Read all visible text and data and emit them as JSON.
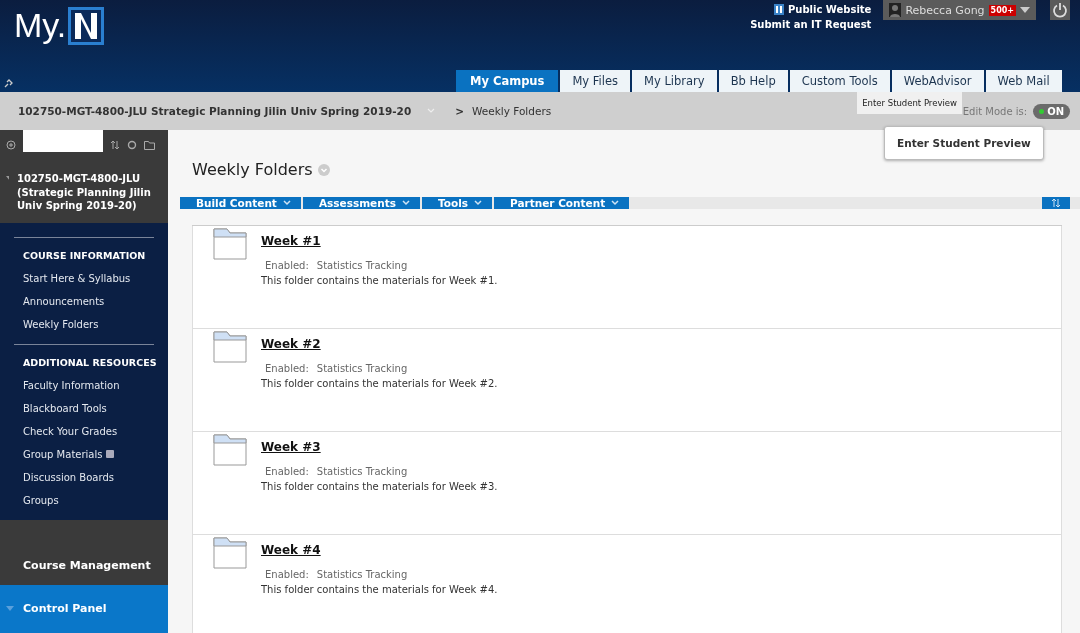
{
  "header": {
    "logo": "My.",
    "links": [
      {
        "label": "Public Website",
        "kind": "logo"
      },
      {
        "label": "Submit an IT Request",
        "kind": "plain"
      }
    ],
    "user": {
      "name": "Rebecca Gong",
      "badge": "500+"
    }
  },
  "tabs": [
    {
      "label": "My Campus",
      "selected": true
    },
    {
      "label": "My Files",
      "selected": false
    },
    {
      "label": "My Library",
      "selected": false
    },
    {
      "label": "Bb Help",
      "selected": false
    },
    {
      "label": "Custom Tools",
      "selected": false
    },
    {
      "label": "WebAdvisor",
      "selected": false
    },
    {
      "label": "Web Mail",
      "selected": false
    }
  ],
  "breadcrumb": {
    "course": "102750-MGT-4800-JLU Strategic Planning Jilin Univ Spring 2019-20",
    "separator": ">",
    "page": "Weekly Folders"
  },
  "edit_mode": {
    "label": "Edit Mode is:",
    "on": true,
    "value": "ON"
  },
  "tooltip": "Enter Student Preview",
  "preview_button": "Enter Student Preview",
  "sidebar": {
    "course": "102750-MGT-4800-JLU (Strategic Planning Jilin Univ Spring 2019-20)",
    "expanded": true,
    "sections": [
      {
        "heading": "COURSE INFORMATION",
        "items": [
          {
            "label": "Start Here & Syllabus",
            "hidden": false
          },
          {
            "label": "Announcements",
            "hidden": false
          },
          {
            "label": "Weekly Folders",
            "hidden": false
          }
        ]
      },
      {
        "heading": "ADDITIONAL RESOURCES",
        "items": [
          {
            "label": "Faculty Information",
            "hidden": false
          },
          {
            "label": "Blackboard Tools",
            "hidden": false
          },
          {
            "label": "Check Your Grades",
            "hidden": false
          },
          {
            "label": "Group Materials",
            "hidden": true
          },
          {
            "label": "Discussion Boards",
            "hidden": false
          },
          {
            "label": "Groups",
            "hidden": false
          }
        ]
      }
    ],
    "management": "Course Management",
    "control_panel": "Control Panel"
  },
  "page_title": "Weekly Folders",
  "action_bar": [
    "Build Content",
    "Assessments",
    "Tools",
    "Partner Content"
  ],
  "folders": [
    {
      "title": "Week #1",
      "enabled_label": "Enabled:",
      "enabled": "Statistics Tracking",
      "description": "This folder contains the materials for Week #1."
    },
    {
      "title": "Week #2",
      "enabled_label": "Enabled:",
      "enabled": "Statistics Tracking",
      "description": "This folder contains the materials for Week #2."
    },
    {
      "title": "Week #3",
      "enabled_label": "Enabled:",
      "enabled": "Statistics Tracking",
      "description": "This folder contains the materials for Week #3."
    },
    {
      "title": "Week #4",
      "enabled_label": "Enabled:",
      "enabled": "Statistics Tracking",
      "description": "This folder contains the materials for Week #4."
    }
  ]
}
